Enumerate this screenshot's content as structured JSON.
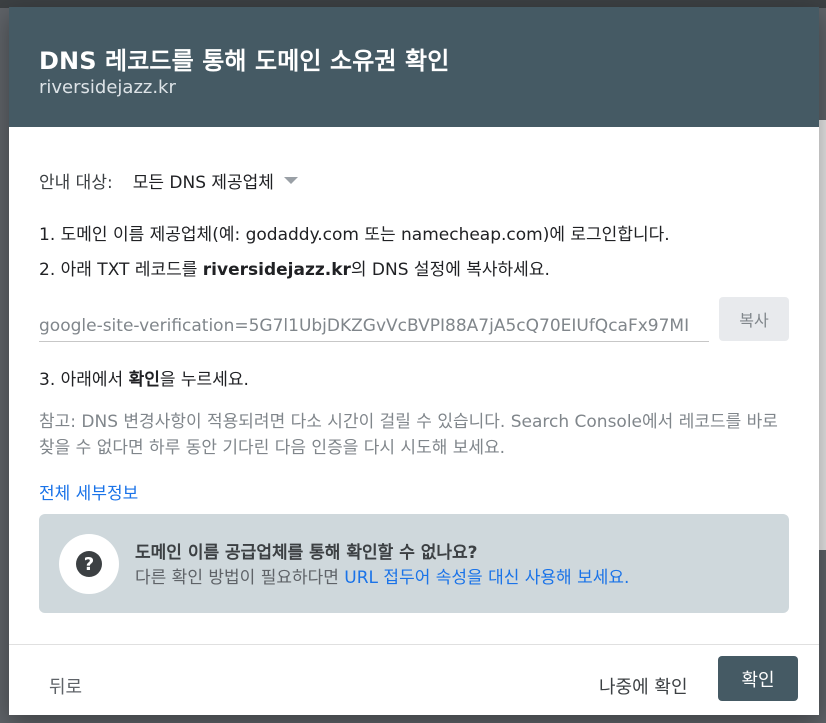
{
  "dialog": {
    "title": "DNS 레코드를 통해 도메인 소유권 확인",
    "domain": "riversidejazz.kr"
  },
  "instructions": {
    "target_label": "안내 대상:",
    "target_value": "모든 DNS 제공업체",
    "step1": "1. 도메인 이름 제공업체(예: godaddy.com 또는 namecheap.com)에 로그인합니다.",
    "step2_prefix": "2. 아래 TXT 레코드를 ",
    "step2_domain": "riversidejazz.kr",
    "step2_suffix": "의 DNS 설정에 복사하세요.",
    "token": "google-site-verification=5G7l1UbjDKZGvVcBVPI88A7jA5cQ70EIUfQcaFx97MI",
    "copy_label": "복사",
    "step3_prefix": "3. 아래에서 ",
    "step3_bold": "확인",
    "step3_suffix": "을 누르세요.",
    "note": "참고: DNS 변경사항이 적용되려면 다소 시간이 걸릴 수 있습니다. Search Console에서 레코드를 바로 찾을 수 없다면 하루 동안 기다린 다음 인증을 다시 시도해 보세요.",
    "full_details": "전체 세부정보"
  },
  "info_box": {
    "icon": "help-circle-icon",
    "question_mark": "?",
    "title": "도메인 이름 공급업체를 통해 확인할 수 없나요?",
    "desc_prefix": "다른 확인 방법이 필요하다면 ",
    "desc_link": "URL 접두어 속성을 대신 사용해 보세요."
  },
  "footer": {
    "back": "뒤로",
    "later": "나중에 확인",
    "confirm": "확인"
  },
  "colors": {
    "header_bg": "#455a64",
    "link": "#1a73e8",
    "info_bg": "#cfd8dc"
  }
}
